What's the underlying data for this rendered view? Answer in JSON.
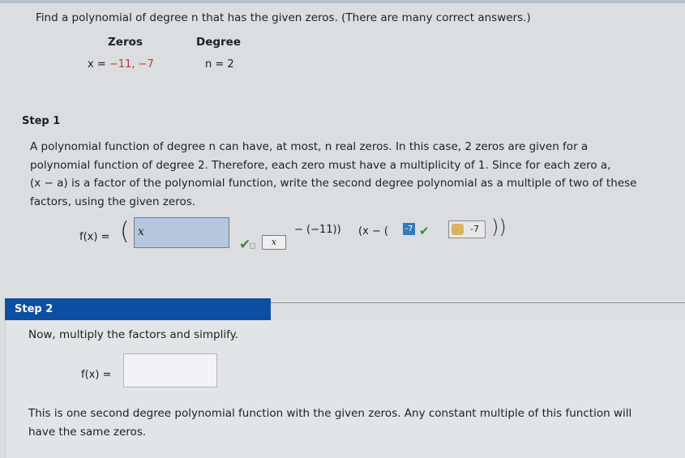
{
  "question": "Find a polynomial of degree n that has the given zeros. (There are many correct answers.)",
  "zeros": {
    "header": "Zeros",
    "value_prefix": "x = ",
    "value": "−11, −7"
  },
  "degree": {
    "header": "Degree",
    "value": "n = 2"
  },
  "step1": {
    "title": "Step 1",
    "paragraph": [
      "A polynomial function of degree n can have, at most, n real zeros. In this case, 2 zeros are given for a",
      "polynomial function of degree 2. Therefore, each zero must have a multiplicity of 1. Since for each zero a,",
      "(x − a) is a factor of the polynomial function, write the second degree polynomial as a multiple of two of these",
      "factors, using the given zeros."
    ],
    "fx_label": "f(x) =",
    "open_paren": "(",
    "input_value": "x",
    "check": "✔",
    "xbtn": "x",
    "minus_term": "− (−11))",
    "factor2_prefix": "(x − (",
    "factor2_box": "-7",
    "check2": "✔",
    "key_value": "-7",
    "close_parens": "))"
  },
  "step2": {
    "title": "Step 2",
    "instruction": "Now, multiply the factors and simplify.",
    "fx_label": "f(x) =",
    "input_value": "",
    "final": [
      "This is one second degree polynomial function with the given zeros. Any constant multiple of this function will",
      "have the same zeros."
    ]
  }
}
